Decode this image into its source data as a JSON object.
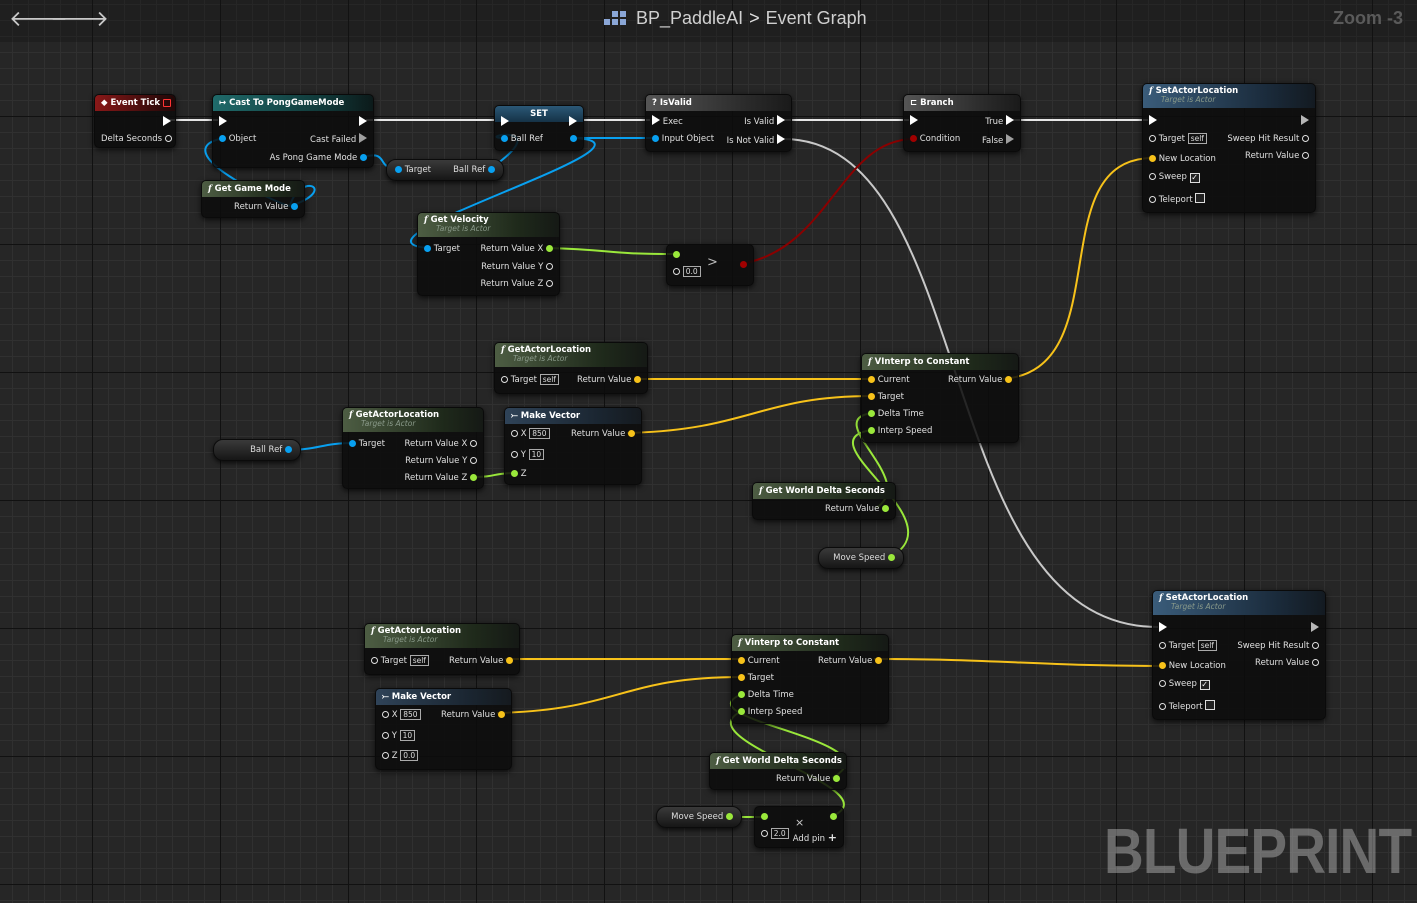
{
  "header": {
    "blueprint_name": "BP_PaddleAI",
    "separator": ">",
    "graph_name": "Event Graph",
    "zoom": "Zoom -3",
    "watermark": "BLUEPRINT"
  },
  "icons": {
    "back": "arrow-left-icon",
    "forward": "arrow-right-icon",
    "blueprint": "blueprint-grid-icon",
    "function": "function-f-icon"
  },
  "colors": {
    "exec": "#ffffff",
    "object": "#08a0f0",
    "vector": "#f7c21a",
    "float": "#9ae83b",
    "bool": "#a00000",
    "struct": "#0a64c8"
  },
  "nodes": {
    "event_tick": {
      "title": "Event Tick",
      "delta": "Delta Seconds"
    },
    "cast": {
      "title": "Cast To PongGameMode",
      "object": "Object",
      "cast_failed": "Cast Failed",
      "as_mode": "As Pong Game Mode"
    },
    "set": {
      "title": "SET",
      "ball_ref": "Ball Ref"
    },
    "ref_node": {
      "target": "Target",
      "ball_ref": "Ball Ref"
    },
    "get_game_mode": {
      "title": "Get Game Mode",
      "return_value": "Return Value"
    },
    "is_valid": {
      "title": "IsValid",
      "exec": "Exec",
      "is_valid": "Is Valid",
      "input_object": "Input Object",
      "is_not_valid": "Is Not Valid"
    },
    "branch": {
      "title": "Branch",
      "true": "True",
      "false": "False",
      "condition": "Condition"
    },
    "get_velocity": {
      "title": "Get Velocity",
      "subtitle": "Target is Actor",
      "target": "Target",
      "rx": "Return Value X",
      "ry": "Return Value Y",
      "rz": "Return Value Z"
    },
    "compare": {
      "value": "0.0",
      "op": ">"
    },
    "set_loc_1": {
      "title": "SetActorLocation",
      "subtitle": "Target is Actor",
      "target": "Target",
      "self": "self",
      "sweep_hit": "Sweep Hit Result",
      "new_location": "New Location",
      "return_value": "Return Value",
      "sweep": "Sweep",
      "teleport": "Teleport"
    },
    "get_loc_1": {
      "title": "GetActorLocation",
      "subtitle": "Target is Actor",
      "target": "Target",
      "self": "self",
      "return_value": "Return Value"
    },
    "vinterp_1": {
      "title": "VInterp to Constant",
      "current": "Current",
      "return_value": "Return Value",
      "target": "Target",
      "delta_time": "Delta Time",
      "interp_speed": "Interp Speed"
    },
    "get_loc_2": {
      "title": "GetActorLocation",
      "subtitle": "Target is Actor",
      "target": "Target",
      "rx": "Return Value X",
      "ry": "Return Value Y",
      "rz": "Return Value Z"
    },
    "ball_ref_var": {
      "label": "Ball Ref"
    },
    "make_vec_1": {
      "title": "Make Vector",
      "x": "X",
      "x_val": "850",
      "y": "Y",
      "y_val": "10",
      "z": "Z",
      "return_value": "Return Value"
    },
    "get_delta_1": {
      "title": "Get World Delta Seconds",
      "return_value": "Return Value"
    },
    "move_speed_1": {
      "label": "Move Speed"
    },
    "set_loc_2": {
      "title": "SetActorLocation",
      "subtitle": "Target is Actor",
      "target": "Target",
      "self": "self",
      "sweep_hit": "Sweep Hit Result",
      "new_location": "New Location",
      "return_value": "Return Value",
      "sweep": "Sweep",
      "teleport": "Teleport"
    },
    "get_loc_3": {
      "title": "GetActorLocation",
      "subtitle": "Target is Actor",
      "target": "Target",
      "self": "self",
      "return_value": "Return Value"
    },
    "vinterp_2": {
      "title": "Vinterp to Constant",
      "current": "Current",
      "return_value": "Return Value",
      "target": "Target",
      "delta_time": "Delta Time",
      "interp_speed": "Interp Speed"
    },
    "make_vec_2": {
      "title": "Make Vector",
      "x": "X",
      "x_val": "850",
      "y": "Y",
      "y_val": "10",
      "z": "Z",
      "z_val": "0.0",
      "return_value": "Return Value"
    },
    "get_delta_2": {
      "title": "Get World Delta Seconds",
      "return_value": "Return Value"
    },
    "move_speed_2": {
      "label": "Move Speed"
    },
    "multiply": {
      "value": "2.0",
      "op": "×",
      "add_pin": "Add pin",
      "plus": "+"
    }
  }
}
